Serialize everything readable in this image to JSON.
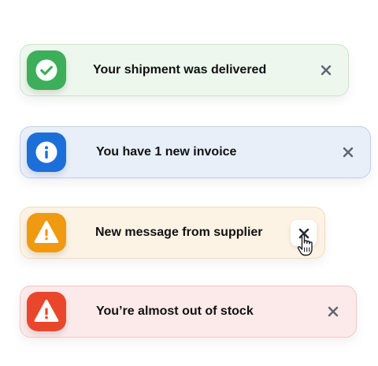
{
  "notifications": [
    {
      "type": "success",
      "message": "Your shipment was delivered",
      "icon": "checkmark-icon",
      "accent": "#3dae5a",
      "background": "#eef7ee"
    },
    {
      "type": "info",
      "message": "You have 1 new invoice",
      "icon": "info-icon",
      "accent": "#1c6fd8",
      "background": "#e8eff9"
    },
    {
      "type": "warning",
      "message": "New message from supplier",
      "icon": "warning-icon",
      "accent": "#f09a12",
      "background": "#fdf3e4",
      "close_hovered": true
    },
    {
      "type": "error",
      "message": "You’re almost out of stock",
      "icon": "warning-icon",
      "accent": "#e9472b",
      "background": "#fceaea"
    }
  ],
  "close_icon": "close-icon",
  "cursor_icon": "pointer-hand-icon"
}
